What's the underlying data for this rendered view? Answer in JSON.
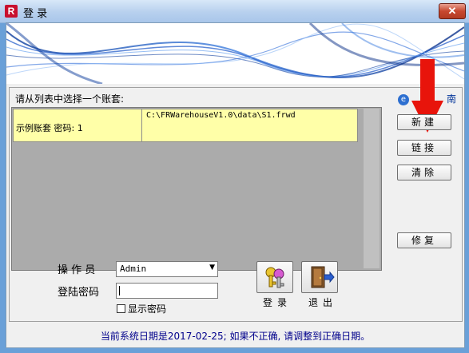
{
  "window": {
    "title": "登 录",
    "close_label": "✕",
    "app_icon_letter": "R"
  },
  "accounts": {
    "label": "请从列表中选择一个账套:",
    "rows": [
      {
        "name": "示例账套 密码: 1",
        "path": "C:\\FRWarehouseV1.0\\data\\S1.frwd"
      }
    ]
  },
  "guide": {
    "label": "南"
  },
  "buttons": {
    "new": "新建",
    "link": "链接",
    "clear": "清除",
    "repair": "修复"
  },
  "form": {
    "operator_label": "操 作 员",
    "operator_value": "Admin",
    "password_label": "登陆密码",
    "password_value": "",
    "show_password_label": "显示密码"
  },
  "actions": {
    "login_label": "登录",
    "exit_label": "退出"
  },
  "status_text": "当前系统日期是2017-02-25; 如果不正确, 请调整到正确日期。",
  "colors": {
    "title_bar": "#b7d0ee",
    "close_button": "#c7472f",
    "row_highlight": "#ffffa8",
    "status_text": "#00008b",
    "annotation_arrow": "#e8140b"
  },
  "icons": {
    "app": "app-logo-icon",
    "guide": "ie-icon",
    "login": "keys-icon",
    "exit": "exit-door-icon",
    "combo": "chevron-down-icon"
  }
}
